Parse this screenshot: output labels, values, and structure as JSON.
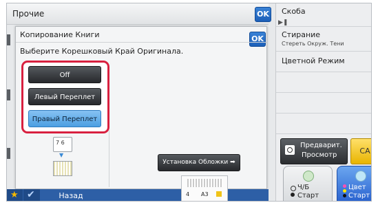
{
  "header": {
    "title": "Прочие",
    "ok_label": "OK"
  },
  "dialog": {
    "title": "Копирование Книги",
    "instruction": "Выберите Корешковый Край Оригинала.",
    "ok_label": "OK",
    "options": [
      {
        "label": "Off",
        "selected": false
      },
      {
        "label": "Левый Переплет",
        "selected": false
      },
      {
        "label": "Правый Переплет",
        "selected": true
      }
    ],
    "preview_pages": "7 6",
    "cover_button": "Установка Обложки"
  },
  "right_panel": {
    "items": [
      {
        "label": "Скоба",
        "sub": ""
      },
      {
        "label": "Стирание",
        "sub": "Стереть Окруж. Тени"
      },
      {
        "label": "Цветной Режим",
        "sub": ""
      }
    ]
  },
  "actions": {
    "preview_line1": "Предварит.",
    "preview_line2": "Просмотр",
    "ca": "CA",
    "bw_line1": "Ч/Б",
    "bw_line2": "Старт",
    "color_line1": "Цвет",
    "color_line2": "Старт"
  },
  "footer": {
    "back": "Назад",
    "tray_count": "4",
    "tray_size": "A3"
  },
  "colors": {
    "highlight": "#d8203f",
    "selected_option": "#6cb4ee",
    "accent": "#1c5fb8",
    "ca": "#f5c400",
    "color_start": "#2a63cf"
  }
}
